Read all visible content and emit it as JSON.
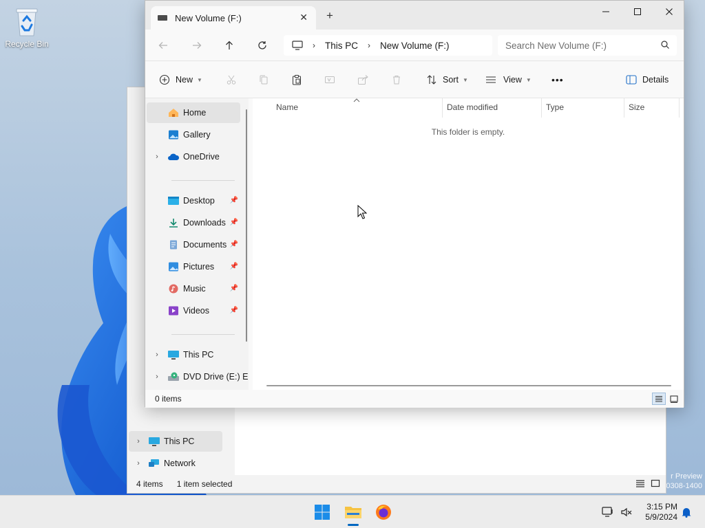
{
  "desktop": {
    "recycle_bin_label": "Recycle Bin",
    "watermark_line1": "r Preview",
    "watermark_line2": "0308-1400"
  },
  "back_window": {
    "nav_items": [
      {
        "label": "This PC",
        "icon": "computer-icon",
        "selected": true
      },
      {
        "label": "Network",
        "icon": "network-icon",
        "selected": false
      }
    ],
    "status": {
      "items_count": "4 items",
      "selection": "1 item selected"
    }
  },
  "window": {
    "tab_title": "New Volume (F:)",
    "address": {
      "root": "This PC",
      "current": "New Volume (F:)"
    },
    "search_placeholder": "Search New Volume (F:)",
    "toolbar": {
      "new_label": "New",
      "sort_label": "Sort",
      "view_label": "View",
      "more_label": "•••",
      "details_label": "Details"
    },
    "nav": {
      "top": [
        {
          "label": "Home",
          "icon": "home-icon",
          "selected": true,
          "expandable": false
        },
        {
          "label": "Gallery",
          "icon": "gallery-icon",
          "selected": false,
          "expandable": false
        },
        {
          "label": "OneDrive",
          "icon": "onedrive-icon",
          "selected": false,
          "expandable": true
        }
      ],
      "quick": [
        {
          "label": "Desktop",
          "icon": "desktop-folder-icon"
        },
        {
          "label": "Downloads",
          "icon": "downloads-icon"
        },
        {
          "label": "Documents",
          "icon": "documents-icon"
        },
        {
          "label": "Pictures",
          "icon": "pictures-icon"
        },
        {
          "label": "Music",
          "icon": "music-icon"
        },
        {
          "label": "Videos",
          "icon": "videos-icon"
        }
      ],
      "devices": [
        {
          "label": "This PC",
          "icon": "computer-icon"
        },
        {
          "label": "DVD Drive (E:) ES",
          "icon": "dvd-drive-icon"
        }
      ]
    },
    "columns": [
      "Name",
      "Date modified",
      "Type",
      "Size"
    ],
    "empty_message": "This folder is empty.",
    "status_text": "0 items"
  },
  "taskbar": {
    "time": "3:15 PM",
    "date": "5/9/2024",
    "apps": [
      "start-icon",
      "file-explorer-icon",
      "firefox-icon"
    ]
  },
  "colors": {
    "accent": "#0067c0",
    "selection_bg": "#e3e3e3",
    "titlebar_bg": "#eaeaea"
  }
}
